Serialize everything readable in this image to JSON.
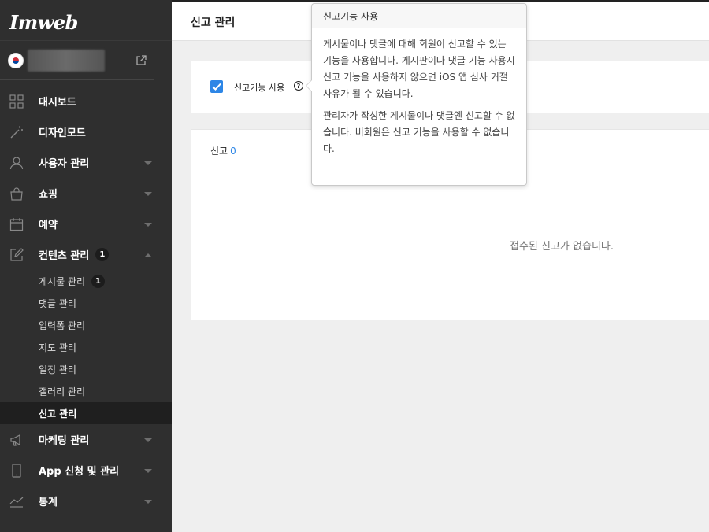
{
  "sidebar": {
    "logo": "Imweb",
    "items": [
      {
        "label": "대시보드",
        "icon": "dashboard-icon"
      },
      {
        "label": "디자인모드",
        "icon": "magic-wand-icon"
      },
      {
        "label": "사용자 관리",
        "icon": "user-icon"
      },
      {
        "label": "쇼핑",
        "icon": "shopping-bag-icon"
      },
      {
        "label": "예약",
        "icon": "calendar-icon"
      },
      {
        "label": "컨텐츠 관리",
        "icon": "edit-icon",
        "badge": "1"
      },
      {
        "label": "마케팅 관리",
        "icon": "megaphone-icon"
      },
      {
        "label": "App 신청 및 관리",
        "icon": "mobile-icon"
      },
      {
        "label": "통계",
        "icon": "chart-line-icon"
      }
    ],
    "submenu": [
      {
        "label": "게시물 관리",
        "badge": "1"
      },
      {
        "label": "댓글 관리"
      },
      {
        "label": "입력폼 관리"
      },
      {
        "label": "지도 관리"
      },
      {
        "label": "일정 관리"
      },
      {
        "label": "갤러리 관리"
      },
      {
        "label": "신고 관리",
        "active": true
      }
    ]
  },
  "header": {
    "title": "신고 관리"
  },
  "settings": {
    "checkbox_label": "신고기능 사용",
    "help_glyph": "?",
    "checked": true
  },
  "reports": {
    "title": "신고",
    "count": "0",
    "empty_message": "접수된 신고가 없습니다."
  },
  "tooltip": {
    "title": "신고기능 사용",
    "paragraph1": "게시물이나 댓글에 대해 회원이 신고할 수 있는 기능을 사용합니다. 게시판이나 댓글 기능 사용시 신고 기능을 사용하지 않으면 iOS 앱 심사 거절 사유가 될 수 있습니다.",
    "paragraph2": "관리자가 작성한 게시물이나 댓글엔 신고할 수 없습니다. 비회원은 신고 기능을 사용할 수 없습니다."
  },
  "colors": {
    "sidebar_bg": "#2f2f2f",
    "accent_blue": "#2d86e6",
    "content_bg": "#efefef"
  }
}
